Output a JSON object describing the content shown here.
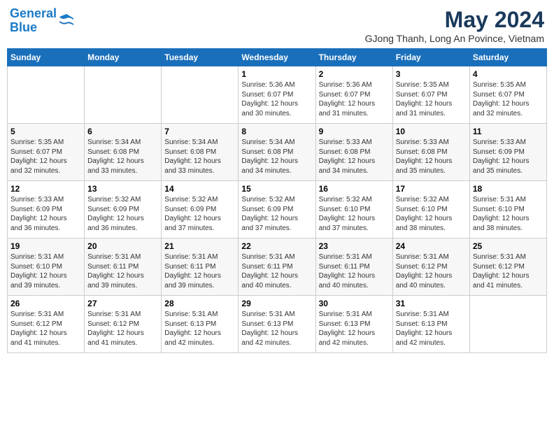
{
  "header": {
    "logo_line1": "General",
    "logo_line2": "Blue",
    "month_year": "May 2024",
    "location": "GJong Thanh, Long An Povince, Vietnam"
  },
  "weekdays": [
    "Sunday",
    "Monday",
    "Tuesday",
    "Wednesday",
    "Thursday",
    "Friday",
    "Saturday"
  ],
  "weeks": [
    [
      {
        "day": "",
        "info": ""
      },
      {
        "day": "",
        "info": ""
      },
      {
        "day": "",
        "info": ""
      },
      {
        "day": "1",
        "info": "Sunrise: 5:36 AM\nSunset: 6:07 PM\nDaylight: 12 hours\nand 30 minutes."
      },
      {
        "day": "2",
        "info": "Sunrise: 5:36 AM\nSunset: 6:07 PM\nDaylight: 12 hours\nand 31 minutes."
      },
      {
        "day": "3",
        "info": "Sunrise: 5:35 AM\nSunset: 6:07 PM\nDaylight: 12 hours\nand 31 minutes."
      },
      {
        "day": "4",
        "info": "Sunrise: 5:35 AM\nSunset: 6:07 PM\nDaylight: 12 hours\nand 32 minutes."
      }
    ],
    [
      {
        "day": "5",
        "info": "Sunrise: 5:35 AM\nSunset: 6:07 PM\nDaylight: 12 hours\nand 32 minutes."
      },
      {
        "day": "6",
        "info": "Sunrise: 5:34 AM\nSunset: 6:08 PM\nDaylight: 12 hours\nand 33 minutes."
      },
      {
        "day": "7",
        "info": "Sunrise: 5:34 AM\nSunset: 6:08 PM\nDaylight: 12 hours\nand 33 minutes."
      },
      {
        "day": "8",
        "info": "Sunrise: 5:34 AM\nSunset: 6:08 PM\nDaylight: 12 hours\nand 34 minutes."
      },
      {
        "day": "9",
        "info": "Sunrise: 5:33 AM\nSunset: 6:08 PM\nDaylight: 12 hours\nand 34 minutes."
      },
      {
        "day": "10",
        "info": "Sunrise: 5:33 AM\nSunset: 6:08 PM\nDaylight: 12 hours\nand 35 minutes."
      },
      {
        "day": "11",
        "info": "Sunrise: 5:33 AM\nSunset: 6:09 PM\nDaylight: 12 hours\nand 35 minutes."
      }
    ],
    [
      {
        "day": "12",
        "info": "Sunrise: 5:33 AM\nSunset: 6:09 PM\nDaylight: 12 hours\nand 36 minutes."
      },
      {
        "day": "13",
        "info": "Sunrise: 5:32 AM\nSunset: 6:09 PM\nDaylight: 12 hours\nand 36 minutes."
      },
      {
        "day": "14",
        "info": "Sunrise: 5:32 AM\nSunset: 6:09 PM\nDaylight: 12 hours\nand 37 minutes."
      },
      {
        "day": "15",
        "info": "Sunrise: 5:32 AM\nSunset: 6:09 PM\nDaylight: 12 hours\nand 37 minutes."
      },
      {
        "day": "16",
        "info": "Sunrise: 5:32 AM\nSunset: 6:10 PM\nDaylight: 12 hours\nand 37 minutes."
      },
      {
        "day": "17",
        "info": "Sunrise: 5:32 AM\nSunset: 6:10 PM\nDaylight: 12 hours\nand 38 minutes."
      },
      {
        "day": "18",
        "info": "Sunrise: 5:31 AM\nSunset: 6:10 PM\nDaylight: 12 hours\nand 38 minutes."
      }
    ],
    [
      {
        "day": "19",
        "info": "Sunrise: 5:31 AM\nSunset: 6:10 PM\nDaylight: 12 hours\nand 39 minutes."
      },
      {
        "day": "20",
        "info": "Sunrise: 5:31 AM\nSunset: 6:11 PM\nDaylight: 12 hours\nand 39 minutes."
      },
      {
        "day": "21",
        "info": "Sunrise: 5:31 AM\nSunset: 6:11 PM\nDaylight: 12 hours\nand 39 minutes."
      },
      {
        "day": "22",
        "info": "Sunrise: 5:31 AM\nSunset: 6:11 PM\nDaylight: 12 hours\nand 40 minutes."
      },
      {
        "day": "23",
        "info": "Sunrise: 5:31 AM\nSunset: 6:11 PM\nDaylight: 12 hours\nand 40 minutes."
      },
      {
        "day": "24",
        "info": "Sunrise: 5:31 AM\nSunset: 6:12 PM\nDaylight: 12 hours\nand 40 minutes."
      },
      {
        "day": "25",
        "info": "Sunrise: 5:31 AM\nSunset: 6:12 PM\nDaylight: 12 hours\nand 41 minutes."
      }
    ],
    [
      {
        "day": "26",
        "info": "Sunrise: 5:31 AM\nSunset: 6:12 PM\nDaylight: 12 hours\nand 41 minutes."
      },
      {
        "day": "27",
        "info": "Sunrise: 5:31 AM\nSunset: 6:12 PM\nDaylight: 12 hours\nand 41 minutes."
      },
      {
        "day": "28",
        "info": "Sunrise: 5:31 AM\nSunset: 6:13 PM\nDaylight: 12 hours\nand 42 minutes."
      },
      {
        "day": "29",
        "info": "Sunrise: 5:31 AM\nSunset: 6:13 PM\nDaylight: 12 hours\nand 42 minutes."
      },
      {
        "day": "30",
        "info": "Sunrise: 5:31 AM\nSunset: 6:13 PM\nDaylight: 12 hours\nand 42 minutes."
      },
      {
        "day": "31",
        "info": "Sunrise: 5:31 AM\nSunset: 6:13 PM\nDaylight: 12 hours\nand 42 minutes."
      },
      {
        "day": "",
        "info": ""
      }
    ]
  ]
}
